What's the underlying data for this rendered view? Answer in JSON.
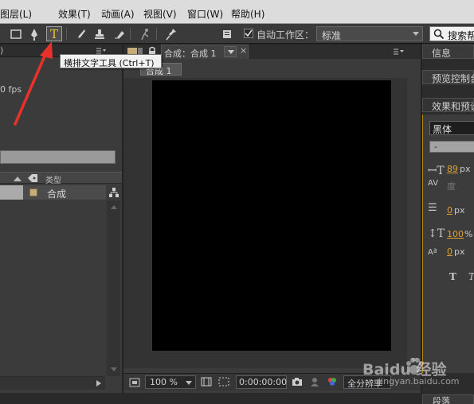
{
  "menu": {
    "items": [
      "图层(L)",
      "效果(T)",
      "动画(A)",
      "视图(V)",
      "窗口(W)",
      "帮助(H)"
    ]
  },
  "toolbar": {
    "active_tool_glyph": "T",
    "workarea_label": "自动工作区：",
    "workspace_value": "标准",
    "search_label": "搜索帮"
  },
  "tooltip": {
    "text": "横排文字工具 (Ctrl+T)"
  },
  "project_panel": {
    "fps_text": "0 fps",
    "type_column_label": "类型",
    "item_name": "合成"
  },
  "comp_panel": {
    "tab_label": "合成：合成 1",
    "close_glyph": "×",
    "subtab_label": "合成 1",
    "zoom_value": "100 %",
    "timecode_value": "0:00:00:00",
    "resolution_value": "全分辨率"
  },
  "right_panel": {
    "tabs": [
      "信息",
      "预览控制台",
      "效果和预设"
    ],
    "font_value": "黑体",
    "style_value": "-",
    "font_size_value": "89",
    "font_size_unit": "px",
    "kerning_label": "度",
    "leading_value": "0",
    "leading_unit": "px",
    "vertical_scale_value": "100",
    "vertical_scale_unit": "%",
    "baseline_shift_value": "0",
    "baseline_shift_unit": "px",
    "bottom_tab": "段落"
  },
  "watermark": {
    "main": "Baidu 经验",
    "sub": "jingyan.baidu.com"
  },
  "colors": {
    "accent": "#e8c33c",
    "arrow_annotation": "#e8312a",
    "canvas": "#000000"
  }
}
